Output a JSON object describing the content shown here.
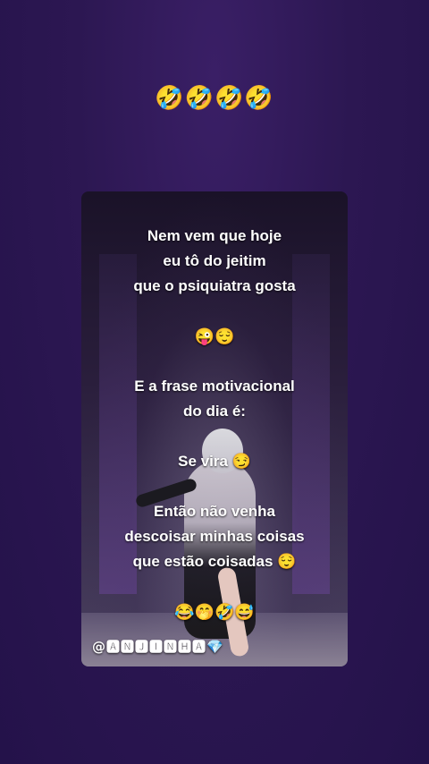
{
  "header": {
    "emojis": "🤣🤣🤣🤣"
  },
  "card": {
    "lines": [
      "Nem vem que hoje",
      "eu tô do jeitim",
      "que o psiquiatra gosta",
      "😜😌",
      "E a frase motivacional",
      "do dia é:",
      "Se vira 😏",
      "Então não venha",
      "descoisar minhas coisas",
      "que estão coisadas 😌",
      "😂🤭🤣😅"
    ],
    "watermark": "@🅰🅽🅹🅸🅽🅷🅰💎"
  }
}
